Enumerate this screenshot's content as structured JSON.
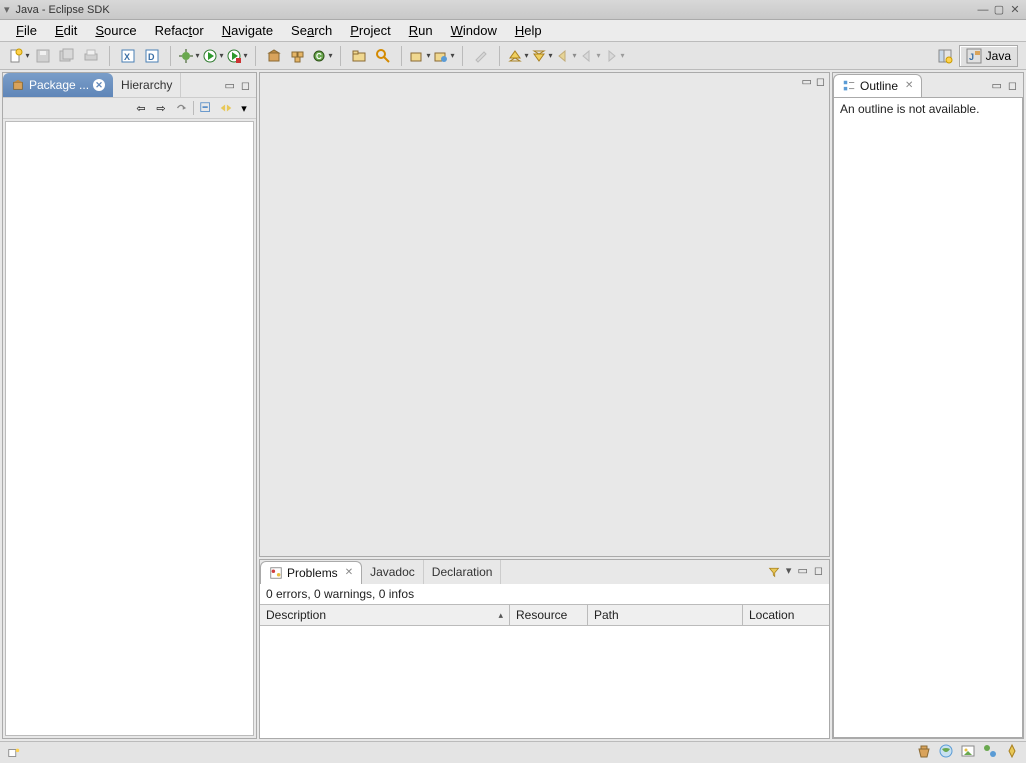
{
  "window": {
    "title": "Java - Eclipse SDK"
  },
  "menu": {
    "file": "File",
    "edit": "Edit",
    "source": "Source",
    "refactor": "Refactor",
    "navigate": "Navigate",
    "search": "Search",
    "project": "Project",
    "run": "Run",
    "window": "Window",
    "help": "Help"
  },
  "perspective": {
    "label": "Java"
  },
  "left": {
    "tabs": {
      "package": "Package ...",
      "hierarchy": "Hierarchy"
    }
  },
  "outline": {
    "tab": "Outline",
    "message": "An outline is not available."
  },
  "problems": {
    "tabs": {
      "problems": "Problems",
      "javadoc": "Javadoc",
      "declaration": "Declaration"
    },
    "summary": "0 errors, 0 warnings, 0 infos",
    "columns": {
      "description": "Description",
      "resource": "Resource",
      "path": "Path",
      "location": "Location"
    }
  }
}
